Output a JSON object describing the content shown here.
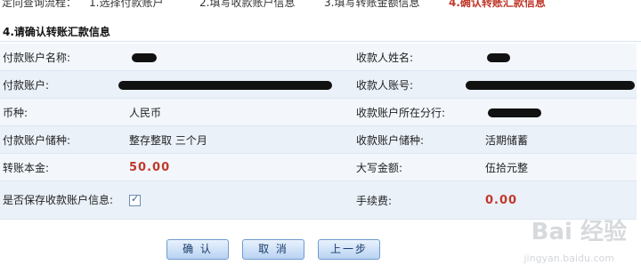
{
  "steps": [
    {
      "label": "定向查询流程："
    },
    {
      "label": "1.选择付款账户"
    },
    {
      "label": "2.填写收款账户信息"
    },
    {
      "label": "3.填写转账金额信息"
    },
    {
      "label": "4.确认转账汇款信息"
    }
  ],
  "section_title": "4.请确认转账汇款信息",
  "rows": [
    {
      "label_left": "付款账户名称:",
      "value_left": "",
      "label_right": "收款人姓名:",
      "value_right": ""
    },
    {
      "label_left": "付款账户:",
      "value_left": "",
      "label_right": "收款人账号:",
      "value_right": ""
    },
    {
      "label_left": "币种:",
      "value_left": "人民币",
      "label_right": "收款账户所在分行:",
      "value_right": ""
    },
    {
      "label_left": "付款账户储种:",
      "value_left": "整存整取 三个月",
      "label_right": "收款账户储种:",
      "value_right": "活期储蓄"
    },
    {
      "label_left": "转账本金:",
      "value_left": "50.00",
      "label_right": "大写金额:",
      "value_right": "伍拾元整"
    },
    {
      "label_left": "是否保存收款账户信息:",
      "value_left": "",
      "label_right": "手续费:",
      "value_right": "0.00"
    }
  ],
  "save_payee_checked": true,
  "buttons": {
    "confirm": "确 认",
    "cancel": "取 消",
    "prev": "上一步"
  },
  "watermark": {
    "brand": "Bai 经验",
    "url": "jingyan.baidu.com"
  },
  "colors": {
    "accent_red": "#c0392b",
    "row_bg_light": "#f3f7fc",
    "row_bg_dark": "#eaf1f9",
    "button_border": "#6f9bd0"
  }
}
